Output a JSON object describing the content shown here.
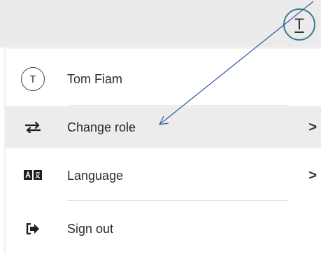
{
  "header": {
    "avatar_initial": "T"
  },
  "menu": {
    "user": {
      "initial": "T",
      "name": "Tom Fiam"
    },
    "items": [
      {
        "label": "Change role",
        "icon": "swap-arrows-icon",
        "has_submenu": true
      },
      {
        "label": "Language",
        "icon": "language-icon",
        "has_submenu": true
      },
      {
        "label": "Sign out",
        "icon": "sign-out-icon",
        "has_submenu": false
      }
    ],
    "chevron": ">"
  },
  "colors": {
    "header_bg": "#ebebeb",
    "highlight_bg": "#ececec",
    "accent": "#3c7f8f",
    "annotation_arrow": "#3a5fa8"
  }
}
